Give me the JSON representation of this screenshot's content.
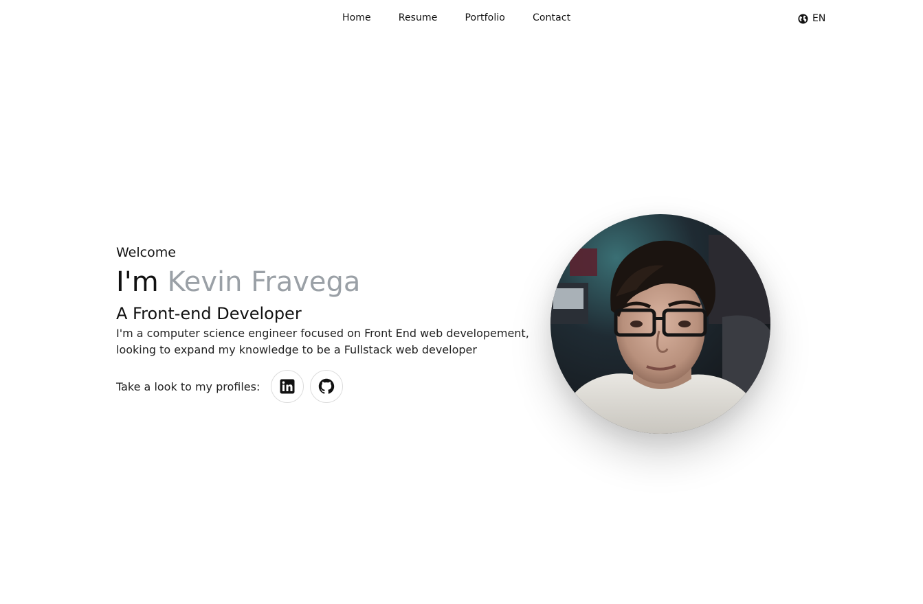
{
  "nav": {
    "links": [
      {
        "label": "Home"
      },
      {
        "label": "Resume"
      },
      {
        "label": "Portfolio"
      },
      {
        "label": "Contact"
      }
    ],
    "language": {
      "label": "EN",
      "icon": "globe-icon"
    }
  },
  "hero": {
    "welcome": "Welcome",
    "greeting_prefix": "I'm ",
    "name": "Kevin Fravega",
    "role": "A Front-end Developer",
    "description": "I'm a computer science engineer focused on Front End web developement, looking to expand my knowledge to be a Fullstack web developer",
    "profiles_label": "Take a look to my profiles:",
    "profiles": [
      {
        "icon": "linkedin-icon"
      },
      {
        "icon": "github-icon"
      }
    ]
  },
  "colors": {
    "name_accent": "#9aa0a6",
    "text": "#111111",
    "background": "#ffffff"
  }
}
